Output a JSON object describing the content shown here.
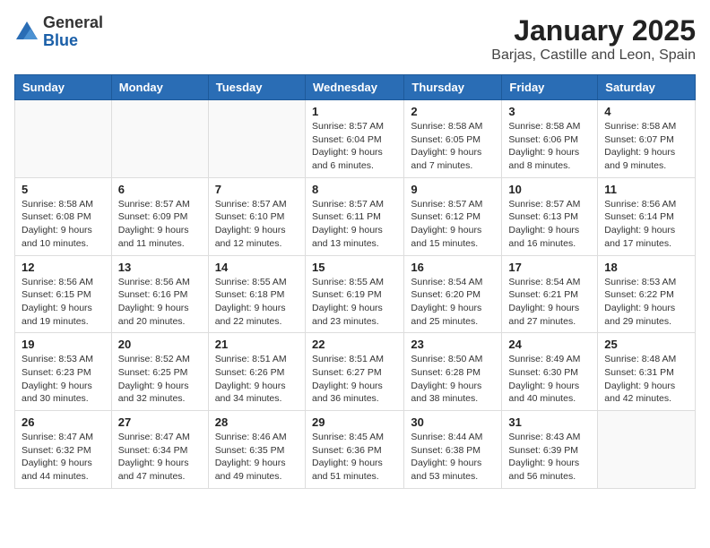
{
  "logo": {
    "general": "General",
    "blue": "Blue"
  },
  "title": "January 2025",
  "subtitle": "Barjas, Castille and Leon, Spain",
  "days_of_week": [
    "Sunday",
    "Monday",
    "Tuesday",
    "Wednesday",
    "Thursday",
    "Friday",
    "Saturday"
  ],
  "weeks": [
    [
      {
        "day": "",
        "info": ""
      },
      {
        "day": "",
        "info": ""
      },
      {
        "day": "",
        "info": ""
      },
      {
        "day": "1",
        "info": "Sunrise: 8:57 AM\nSunset: 6:04 PM\nDaylight: 9 hours and 6 minutes."
      },
      {
        "day": "2",
        "info": "Sunrise: 8:58 AM\nSunset: 6:05 PM\nDaylight: 9 hours and 7 minutes."
      },
      {
        "day": "3",
        "info": "Sunrise: 8:58 AM\nSunset: 6:06 PM\nDaylight: 9 hours and 8 minutes."
      },
      {
        "day": "4",
        "info": "Sunrise: 8:58 AM\nSunset: 6:07 PM\nDaylight: 9 hours and 9 minutes."
      }
    ],
    [
      {
        "day": "5",
        "info": "Sunrise: 8:58 AM\nSunset: 6:08 PM\nDaylight: 9 hours and 10 minutes."
      },
      {
        "day": "6",
        "info": "Sunrise: 8:57 AM\nSunset: 6:09 PM\nDaylight: 9 hours and 11 minutes."
      },
      {
        "day": "7",
        "info": "Sunrise: 8:57 AM\nSunset: 6:10 PM\nDaylight: 9 hours and 12 minutes."
      },
      {
        "day": "8",
        "info": "Sunrise: 8:57 AM\nSunset: 6:11 PM\nDaylight: 9 hours and 13 minutes."
      },
      {
        "day": "9",
        "info": "Sunrise: 8:57 AM\nSunset: 6:12 PM\nDaylight: 9 hours and 15 minutes."
      },
      {
        "day": "10",
        "info": "Sunrise: 8:57 AM\nSunset: 6:13 PM\nDaylight: 9 hours and 16 minutes."
      },
      {
        "day": "11",
        "info": "Sunrise: 8:56 AM\nSunset: 6:14 PM\nDaylight: 9 hours and 17 minutes."
      }
    ],
    [
      {
        "day": "12",
        "info": "Sunrise: 8:56 AM\nSunset: 6:15 PM\nDaylight: 9 hours and 19 minutes."
      },
      {
        "day": "13",
        "info": "Sunrise: 8:56 AM\nSunset: 6:16 PM\nDaylight: 9 hours and 20 minutes."
      },
      {
        "day": "14",
        "info": "Sunrise: 8:55 AM\nSunset: 6:18 PM\nDaylight: 9 hours and 22 minutes."
      },
      {
        "day": "15",
        "info": "Sunrise: 8:55 AM\nSunset: 6:19 PM\nDaylight: 9 hours and 23 minutes."
      },
      {
        "day": "16",
        "info": "Sunrise: 8:54 AM\nSunset: 6:20 PM\nDaylight: 9 hours and 25 minutes."
      },
      {
        "day": "17",
        "info": "Sunrise: 8:54 AM\nSunset: 6:21 PM\nDaylight: 9 hours and 27 minutes."
      },
      {
        "day": "18",
        "info": "Sunrise: 8:53 AM\nSunset: 6:22 PM\nDaylight: 9 hours and 29 minutes."
      }
    ],
    [
      {
        "day": "19",
        "info": "Sunrise: 8:53 AM\nSunset: 6:23 PM\nDaylight: 9 hours and 30 minutes."
      },
      {
        "day": "20",
        "info": "Sunrise: 8:52 AM\nSunset: 6:25 PM\nDaylight: 9 hours and 32 minutes."
      },
      {
        "day": "21",
        "info": "Sunrise: 8:51 AM\nSunset: 6:26 PM\nDaylight: 9 hours and 34 minutes."
      },
      {
        "day": "22",
        "info": "Sunrise: 8:51 AM\nSunset: 6:27 PM\nDaylight: 9 hours and 36 minutes."
      },
      {
        "day": "23",
        "info": "Sunrise: 8:50 AM\nSunset: 6:28 PM\nDaylight: 9 hours and 38 minutes."
      },
      {
        "day": "24",
        "info": "Sunrise: 8:49 AM\nSunset: 6:30 PM\nDaylight: 9 hours and 40 minutes."
      },
      {
        "day": "25",
        "info": "Sunrise: 8:48 AM\nSunset: 6:31 PM\nDaylight: 9 hours and 42 minutes."
      }
    ],
    [
      {
        "day": "26",
        "info": "Sunrise: 8:47 AM\nSunset: 6:32 PM\nDaylight: 9 hours and 44 minutes."
      },
      {
        "day": "27",
        "info": "Sunrise: 8:47 AM\nSunset: 6:34 PM\nDaylight: 9 hours and 47 minutes."
      },
      {
        "day": "28",
        "info": "Sunrise: 8:46 AM\nSunset: 6:35 PM\nDaylight: 9 hours and 49 minutes."
      },
      {
        "day": "29",
        "info": "Sunrise: 8:45 AM\nSunset: 6:36 PM\nDaylight: 9 hours and 51 minutes."
      },
      {
        "day": "30",
        "info": "Sunrise: 8:44 AM\nSunset: 6:38 PM\nDaylight: 9 hours and 53 minutes."
      },
      {
        "day": "31",
        "info": "Sunrise: 8:43 AM\nSunset: 6:39 PM\nDaylight: 9 hours and 56 minutes."
      },
      {
        "day": "",
        "info": ""
      }
    ]
  ]
}
